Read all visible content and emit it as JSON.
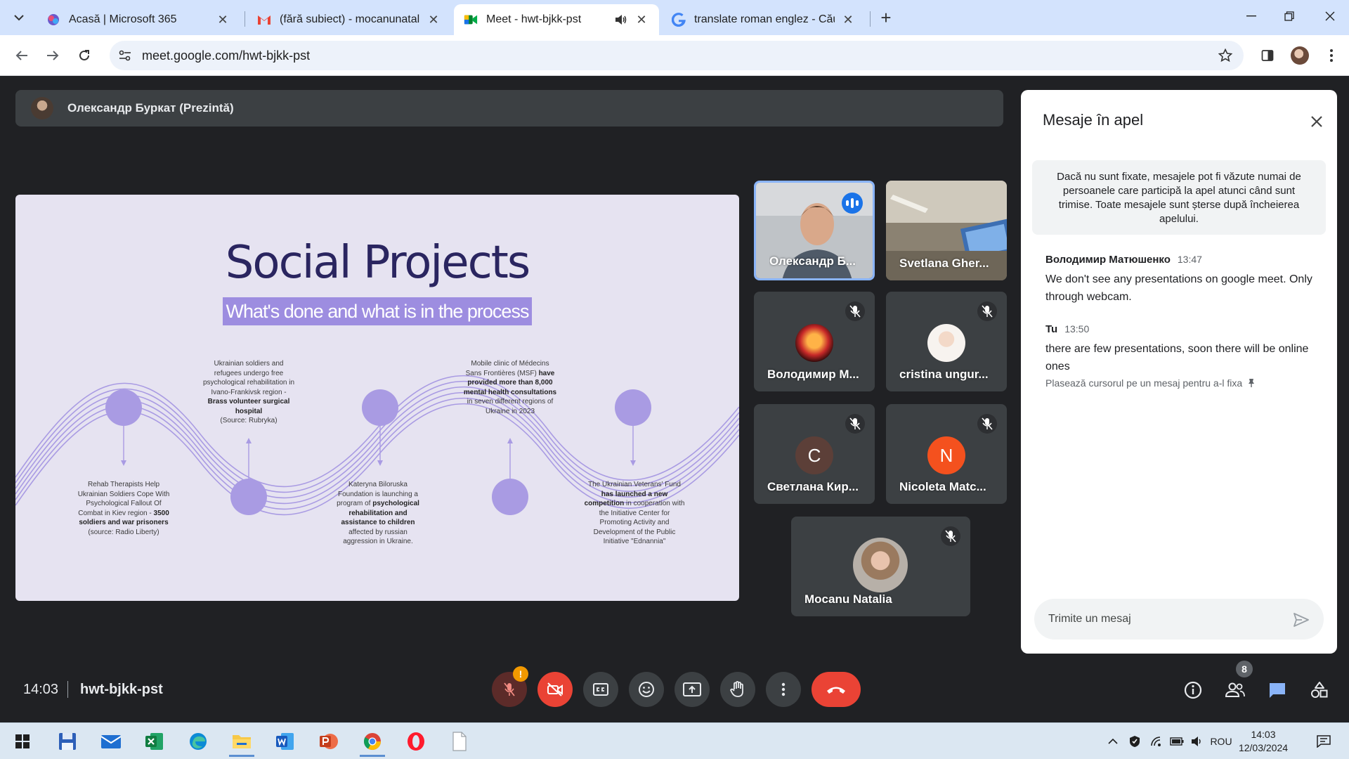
{
  "browser": {
    "tabs": [
      {
        "title": "Acasă | Microsoft 365",
        "icon": "microsoft365-icon"
      },
      {
        "title": "(fără subiect) - mocanunatalia@",
        "icon": "gmail-icon"
      },
      {
        "title": "Meet - hwt-bjkk-pst",
        "icon": "meet-icon",
        "active": true
      },
      {
        "title": "translate roman englez - Căutar",
        "icon": "google-icon"
      }
    ],
    "url": "meet.google.com/hwt-bjkk-pst"
  },
  "meet": {
    "presenter_label": "Олександр Буркат (Prezintă)",
    "slide": {
      "title": "Social Projects",
      "subtitle": "What's done and what is in the process",
      "blocks": {
        "b1": {
          "pre": "Rehab Therapists Help Ukrainian Soldiers Cope With Psychological Fallout Of Combat in Kiev region - ",
          "bold": "3500 soldiers and war prisoners",
          "post": "(source: Radio Liberty)"
        },
        "b2": {
          "pre": "Ukrainian soldiers and refugees undergo free psychological rehabilitation in Ivano-Frankivsk region - ",
          "bold": "Brass volunteer surgical hospital",
          "post": "(Source: Rubryka)"
        },
        "b3": {
          "pre": "Kateryna Biloruska Foundation is launching a program of ",
          "bold": "psychological rehabilitation and assistance to children",
          "post": "affected by russian aggression in Ukraine."
        },
        "b4": {
          "pre": "Mobile clinic of Médecins Sans Frontières (MSF) ",
          "bold": "have provided more than 8,000 mental health consultations",
          "post": "in seven different regions of Ukraine in 2023"
        },
        "b5": {
          "pre": "The Ukrainian Veterans' Fund ",
          "bold": "has launched a new competition",
          "post": "in cooperation with the Initiative Center for Promoting Activity and Development of the Public Initiative \"Ednannia\""
        }
      }
    },
    "participants": [
      {
        "name": "Олександр Б...",
        "speaking": true
      },
      {
        "name": "Svetlana Gher..."
      },
      {
        "name": "Володимир М...",
        "muted": true
      },
      {
        "name": "cristina ungur...",
        "muted": true
      },
      {
        "name": "Светлана Кир...",
        "muted": true,
        "initial": "C",
        "color": "#5c3f38"
      },
      {
        "name": "Nicoleta Matc...",
        "muted": true,
        "initial": "N",
        "color": "#f4511e"
      },
      {
        "name": "Mocanu Natalia",
        "muted": true
      }
    ],
    "chat": {
      "title": "Mesaje în apel",
      "notice": "Dacă nu sunt fixate, mesajele pot fi văzute numai de persoanele care participă la apel atunci când sunt trimise. Toate mesajele sunt șterse după încheierea apelului.",
      "messages": [
        {
          "sender": "Володимир Матюшенко",
          "time": "13:47",
          "text": "We don't see any presentations on google meet. Only through webcam."
        },
        {
          "sender": "Tu",
          "time": "13:50",
          "text": "there are few presentations, soon there will be online ones"
        }
      ],
      "pin_hint": "Plasează cursorul pe un mesaj pentru a-l fixa",
      "input_placeholder": "Trimite un mesaj"
    },
    "bottom": {
      "time": "14:03",
      "code": "hwt-bjkk-pst",
      "mic_warning": "!",
      "people_count": "8"
    }
  },
  "taskbar": {
    "language": "ROU",
    "time": "14:03",
    "date": "12/03/2024"
  },
  "colors": {
    "meet_bg": "#202124",
    "tile_bg": "#3c4043",
    "danger": "#ea4335",
    "accent": "#1a73e8",
    "slide_bg": "#e6e3f1",
    "slide_purple": "#9d8de0",
    "wave": "#a99be3"
  }
}
